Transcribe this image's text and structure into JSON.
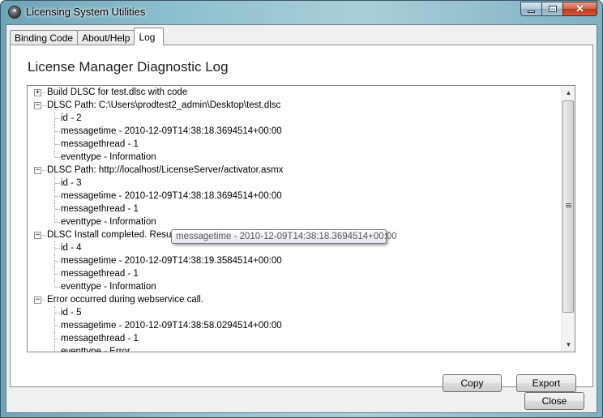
{
  "window": {
    "title": "Licensing System Utilities"
  },
  "tabs": [
    {
      "label": "Binding Code",
      "active": false
    },
    {
      "label": "About/Help",
      "active": false
    },
    {
      "label": "Log",
      "active": true
    }
  ],
  "page_title": "License Manager Diagnostic Log",
  "tree": [
    {
      "label": "Build DLSC for test.dlsc with code",
      "expanded": false,
      "children": []
    },
    {
      "label": "DLSC Path: C:\\Users\\prodtest2_admin\\Desktop\\test.dlsc",
      "expanded": true,
      "children": [
        "id - 2",
        "messagetime - 2010-12-09T14:38:18.3694514+00:00",
        "messagethread - 1",
        "eventtype - Information"
      ]
    },
    {
      "label": "DLSC Path: http://localhost/LicenseServer/activator.asmx",
      "expanded": true,
      "children": [
        "id - 3",
        "messagetime - 2010-12-09T14:38:18.3694514+00:00",
        "messagethread - 1",
        "eventtype - Information"
      ]
    },
    {
      "label": "DLSC Install completed. Result: NoError",
      "expanded": true,
      "children": [
        "id - 4",
        "messagetime - 2010-12-09T14:38:19.3584514+00:00",
        "messagethread - 1",
        "eventtype - Information"
      ]
    },
    {
      "label": "Error occurred during webservice call.",
      "expanded": true,
      "children": [
        "id - 5",
        "messagetime - 2010-12-09T14:38:58.0294514+00:00",
        "messagethread - 1",
        "eventtype - Error"
      ]
    }
  ],
  "tooltip": "messagetime - 2010-12-09T14:38:18.3694514+00:00",
  "buttons": {
    "copy": "Copy",
    "export": "Export",
    "close": "Close"
  },
  "glyphs": {
    "expanded": "−",
    "collapsed": "+",
    "scroll_up": "▲",
    "scroll_down": "▼",
    "close": "✕"
  }
}
